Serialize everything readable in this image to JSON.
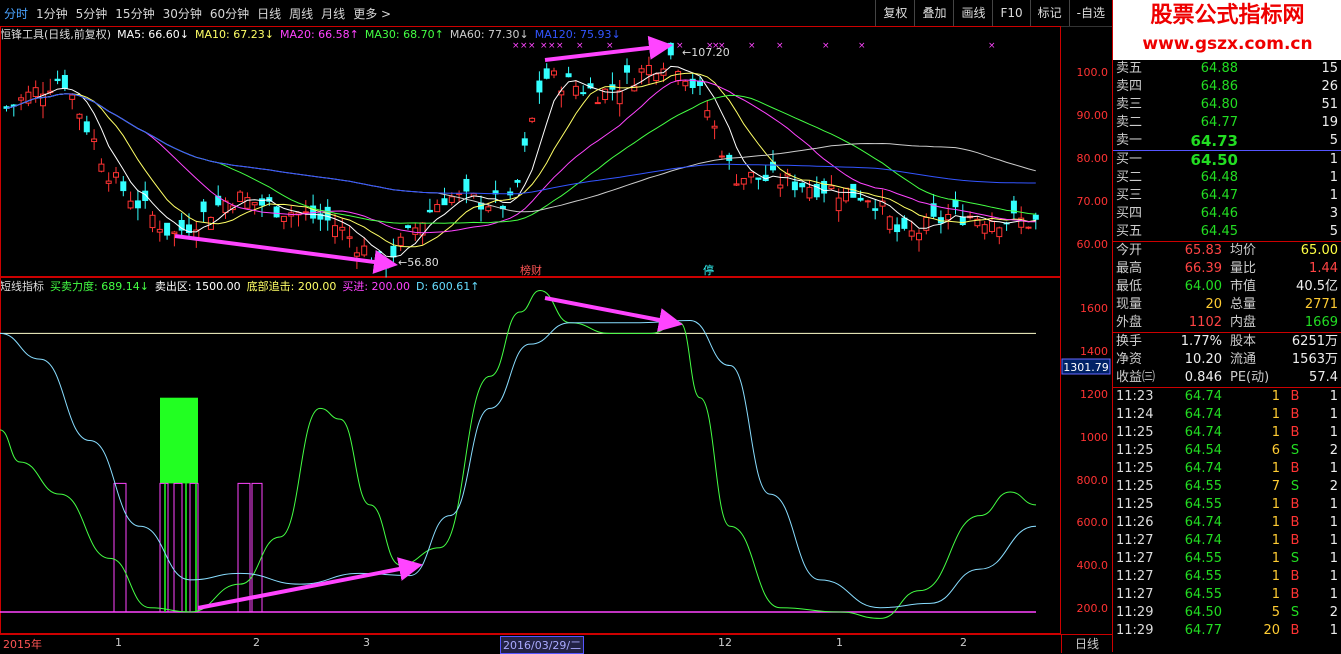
{
  "toolbar": {
    "periods": [
      "分时",
      "1分钟",
      "5分钟",
      "15分钟",
      "30分钟",
      "60分钟",
      "日线",
      "周线",
      "月线",
      "更多 >"
    ],
    "buttons": [
      "复权",
      "叠加",
      "画线",
      "F10",
      "标记",
      "-自选"
    ]
  },
  "ma_bar": {
    "title": "恒锋工具(日线,前复权)",
    "items": [
      {
        "label": "MA5: 66.60↓",
        "color": "#ffffff"
      },
      {
        "label": "MA10: 67.23↓",
        "color": "#ffff66"
      },
      {
        "label": "MA20: 66.58↑",
        "color": "#ff44ff"
      },
      {
        "label": "MA30: 68.70↑",
        "color": "#44ff44"
      },
      {
        "label": "MA60: 77.30↓",
        "color": "#cccccc"
      },
      {
        "label": "MA120: 75.93↓",
        "color": "#3355ff"
      }
    ]
  },
  "ind_bar": {
    "title": "短线指标",
    "items": [
      {
        "label": "买卖力度: 689.14↓",
        "color": "#44ff44"
      },
      {
        "label": "卖出区: 1500.00",
        "color": "#ffffff"
      },
      {
        "label": "底部追击: 200.00",
        "color": "#ffff66"
      },
      {
        "label": "买进: 200.00",
        "color": "#ff44ff"
      },
      {
        "label": "D: 600.61↑",
        "color": "#66ddff"
      }
    ]
  },
  "price_axis": [
    "100.0",
    "90.00",
    "80.00",
    "70.00",
    "60.00"
  ],
  "ind_axis": [
    "1600",
    "1400",
    "1200",
    "1000",
    "800.0",
    "600.0",
    "400.0",
    "200.0"
  ],
  "annotations": {
    "high": "107.20",
    "low": "56.80",
    "cursor_value": "1301.79",
    "tag1": "榜财",
    "tag2": "停"
  },
  "bottom": {
    "year": "2015年",
    "date_labels": [
      "1",
      "2",
      "3",
      "12",
      "1",
      "2"
    ],
    "cursor_date": "2016/03/29/二",
    "day_button": "日线"
  },
  "logo": {
    "line1": "股票公式指标网",
    "line2": "www.gszx.com.cn"
  },
  "orderbook": [
    {
      "label": "卖五",
      "price": "64.88",
      "vol": "15"
    },
    {
      "label": "卖四",
      "price": "64.86",
      "vol": "26"
    },
    {
      "label": "卖三",
      "price": "64.80",
      "vol": "51"
    },
    {
      "label": "卖二",
      "price": "64.77",
      "vol": "19"
    },
    {
      "label": "卖一",
      "price": "64.73",
      "vol": "5"
    },
    {
      "label": "买一",
      "price": "64.50",
      "vol": "1"
    },
    {
      "label": "买二",
      "price": "64.48",
      "vol": "1"
    },
    {
      "label": "买三",
      "price": "64.47",
      "vol": "1"
    },
    {
      "label": "买四",
      "price": "64.46",
      "vol": "3"
    },
    {
      "label": "买五",
      "price": "64.45",
      "vol": "5"
    }
  ],
  "quote": [
    {
      "k1": "今开",
      "v1": "65.83",
      "c1": "#ff4444",
      "k2": "均价",
      "v2": "65.00",
      "c2": "#ffff44"
    },
    {
      "k1": "最高",
      "v1": "66.39",
      "c1": "#ff4444",
      "k2": "量比",
      "v2": "1.44",
      "c2": "#ff4444"
    },
    {
      "k1": "最低",
      "v1": "64.00",
      "c1": "#22dd22",
      "k2": "市值",
      "v2": "40.5亿",
      "c2": "#eeeeee"
    },
    {
      "k1": "现量",
      "v1": "20",
      "c1": "#ffcc33",
      "k2": "总量",
      "v2": "2771",
      "c2": "#ffcc33"
    },
    {
      "k1": "外盘",
      "v1": "1102",
      "c1": "#ff4444",
      "k2": "内盘",
      "v2": "1669",
      "c2": "#22dd22"
    },
    {
      "k1": "换手",
      "v1": "1.77%",
      "c1": "#eeeeee",
      "k2": "股本",
      "v2": "6251万",
      "c2": "#eeeeee"
    },
    {
      "k1": "净资",
      "v1": "10.20",
      "c1": "#eeeeee",
      "k2": "流通",
      "v2": "1563万",
      "c2": "#eeeeee"
    },
    {
      "k1": "收益㈢",
      "v1": "0.846",
      "c1": "#eeeeee",
      "k2": "PE(动)",
      "v2": "57.4",
      "c2": "#eeeeee"
    }
  ],
  "ticks": [
    {
      "t": "11:23",
      "p": "64.74",
      "v": "1",
      "s": "B",
      "n": "1"
    },
    {
      "t": "11:24",
      "p": "64.74",
      "v": "1",
      "s": "B",
      "n": "1"
    },
    {
      "t": "11:25",
      "p": "64.74",
      "v": "1",
      "s": "B",
      "n": "1"
    },
    {
      "t": "11:25",
      "p": "64.54",
      "v": "6",
      "s": "S",
      "n": "2"
    },
    {
      "t": "11:25",
      "p": "64.74",
      "v": "1",
      "s": "B",
      "n": "1"
    },
    {
      "t": "11:25",
      "p": "64.55",
      "v": "7",
      "s": "S",
      "n": "2"
    },
    {
      "t": "11:25",
      "p": "64.55",
      "v": "1",
      "s": "B",
      "n": "1"
    },
    {
      "t": "11:26",
      "p": "64.74",
      "v": "1",
      "s": "B",
      "n": "1"
    },
    {
      "t": "11:27",
      "p": "64.74",
      "v": "1",
      "s": "B",
      "n": "1"
    },
    {
      "t": "11:27",
      "p": "64.55",
      "v": "1",
      "s": "S",
      "n": "1"
    },
    {
      "t": "11:27",
      "p": "64.55",
      "v": "1",
      "s": "B",
      "n": "1"
    },
    {
      "t": "11:27",
      "p": "64.55",
      "v": "1",
      "s": "B",
      "n": "1"
    },
    {
      "t": "11:29",
      "p": "64.50",
      "v": "5",
      "s": "S",
      "n": "2"
    },
    {
      "t": "11:29",
      "p": "64.77",
      "v": "20",
      "s": "B",
      "n": "1"
    }
  ]
}
